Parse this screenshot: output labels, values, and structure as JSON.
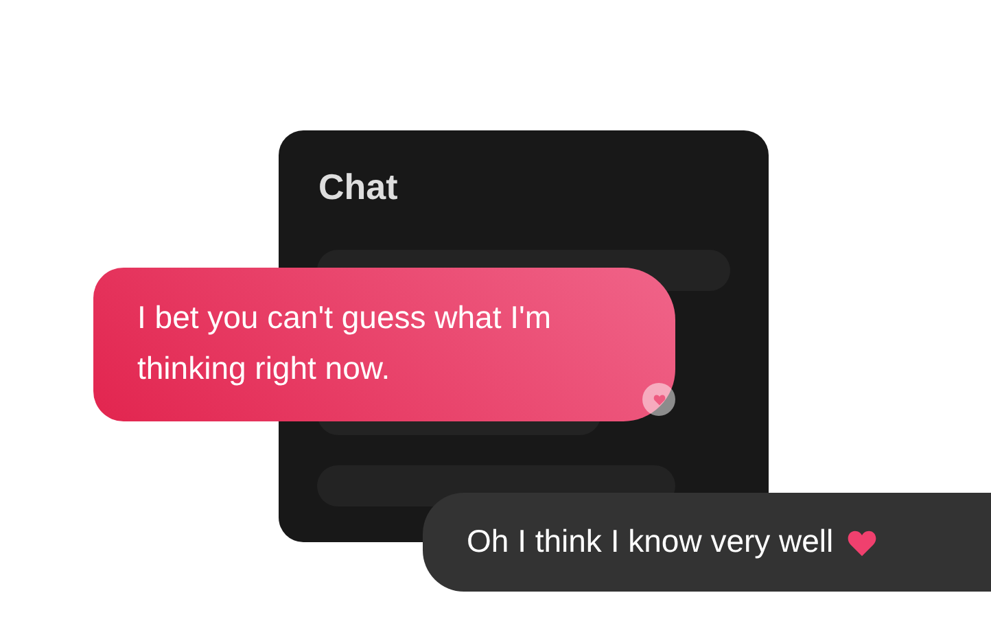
{
  "card": {
    "title": "Chat"
  },
  "messages": [
    {
      "kind": "incoming",
      "text": "I bet you can't guess what I'm thinking right now."
    },
    {
      "kind": "outgoing",
      "text": "Oh I think I know very well"
    }
  ]
}
